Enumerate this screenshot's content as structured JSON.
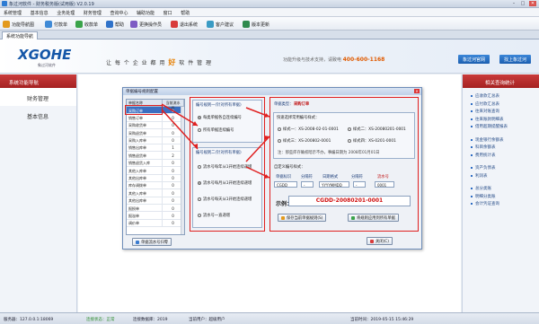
{
  "window": {
    "title": "象过河软件 - 财务税务版(试用版) V2.0.19",
    "minimize": "–",
    "maximize": "□",
    "close": "✕"
  },
  "menu": [
    "系统管理",
    "基本信息",
    "业务处理",
    "财务管理",
    "查询中心",
    "辅助功能",
    "窗口",
    "帮助"
  ],
  "toolbar": [
    {
      "label": "功能导航图",
      "color": "#e39a1d"
    },
    {
      "label": "付款单",
      "color": "#3f8ad6"
    },
    {
      "label": "收款单",
      "color": "#3aa34a"
    },
    {
      "label": "帮助",
      "color": "#2f72c9"
    },
    {
      "label": "更换操作员",
      "color": "#7d5bc4"
    },
    {
      "label": "退出系统",
      "color": "#d83b3b"
    },
    {
      "label": "客户建议",
      "color": "#3a9bc4"
    },
    {
      "label": "版本更新",
      "color": "#2f8a4e"
    }
  ],
  "tab": "系统功能导航",
  "header": {
    "logo": "XGOHE",
    "logo_sub": "象过河软件",
    "slogan_pre": "让 每 个 企 业 都 用",
    "slogan_em": "好",
    "slogan_post": "软 件 管 理",
    "phone_pre": "功能升级与技术支持，请致电",
    "phone": "400-600-1168",
    "btn_official": "象过河官网",
    "btn_store": "找上象过河"
  },
  "left": {
    "header": "系统功能导航",
    "items": [
      "财务管理",
      "基本信息"
    ]
  },
  "right": {
    "header": "相关查询统计",
    "groups": [
      [
        "应收款汇总表",
        "应付款汇总表",
        "往来对账查询",
        "往来账款明细表",
        "借用超期提醒报表"
      ],
      [
        "现金银行余额表",
        "科目余额表",
        "费用统计表"
      ],
      [
        "资产负债表",
        "利润表"
      ],
      [
        "总分类账",
        "明细分类账",
        "会计凭证查询"
      ]
    ]
  },
  "dialog": {
    "title": "单据编号规则配置",
    "grid_headers": [
      "单据名称",
      "当前流水号"
    ],
    "grid_rows": [
      [
        "采购订单",
        "0"
      ],
      [
        "销售订单",
        "0"
      ],
      [
        "采购收货单",
        "0"
      ],
      [
        "采购退货单",
        "0"
      ],
      [
        "采购入库单",
        "0"
      ],
      [
        "销售出库单",
        "1"
      ],
      [
        "销售退货单",
        "2"
      ],
      [
        "销售退货入库",
        "0"
      ],
      [
        "其他入库单",
        "0"
      ],
      [
        "其他出库单",
        "0"
      ],
      [
        "库存调拨单",
        "0"
      ],
      [
        "其他入库单",
        "0"
      ],
      [
        "其他出库单",
        "0"
      ],
      [
        "报损单",
        "0"
      ],
      [
        "报溢单",
        "0"
      ],
      [
        "调价单",
        "0"
      ]
    ],
    "btn_reset_serial": "单据流水号归零",
    "mode1_title": "编号规则一(针对所有单据)",
    "mode1_opts": [
      "每类单据各自连续编号",
      "所有单据连续编号"
    ],
    "mode2_title": "编号规则二(针对所有单据)",
    "mode2_opts": [
      "流水号每年从1开始连续递增",
      "流水号每月从1开始连续递增",
      "流水号每天从1开始连续递增",
      "流水号一直递增"
    ],
    "right_title_label": "单据类型：",
    "right_title_value": "采购订单",
    "preset_label": "快速选择常用编号样式：",
    "presets": [
      "样式一：XS-2008-02-01-0001",
      "样式二：XS-20080201-0001",
      "样式三：XS-200802-0001",
      "样式四：XS-0201-0001"
    ],
    "note": "注：那些库存确权暗示不办，事编日期为 2008年01月01日",
    "custom_label": "自定义编号样式：",
    "col_headers": [
      "单据标识",
      "分隔符",
      "日期格式",
      "分隔符",
      "流水号"
    ],
    "col_values": [
      "CGDD",
      "-",
      "YYYYMMDD",
      "-",
      "0001"
    ],
    "example_label": "示例：",
    "example_value": "CGDD-20080201-0001",
    "btn_save": "保存当前单据规则(S)",
    "btn_apply": "将规则应用到所有单据",
    "btn_close": "关闭(C)"
  },
  "status": {
    "server": "服务器：127.0.0.1:18069",
    "conn": "连接状态：正常",
    "db": "连接数据库：2019",
    "user": "当前用户：超级用户",
    "time": "当前时间：2019-05-15 15:46:29"
  },
  "colors": {
    "accent_red": "#e02020",
    "brand_blue": "#1557a8",
    "highlight_orange": "#e67e00"
  }
}
